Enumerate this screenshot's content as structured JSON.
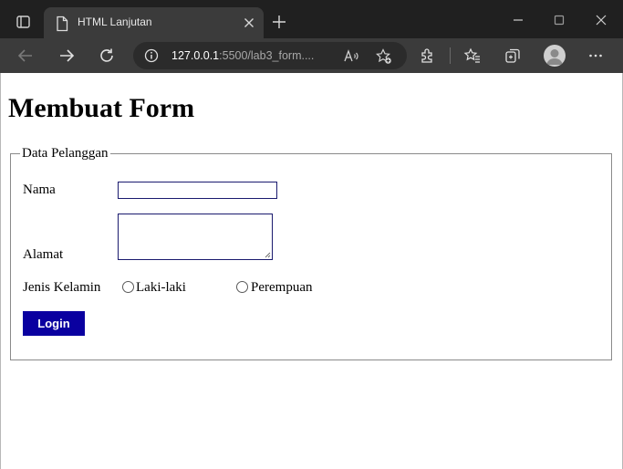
{
  "browser": {
    "tab": {
      "title": "HTML Lanjutan"
    },
    "address_bar": {
      "host": "127.0.0.1",
      "path": ":5500/lab3_form...."
    }
  },
  "page": {
    "heading": "Membuat Form",
    "fieldset_legend": "Data Pelanggan",
    "fields": {
      "name_label": "Nama",
      "name_value": "",
      "address_label": "Alamat",
      "address_value": "",
      "gender_label": "Jenis Kelamin",
      "gender_options": [
        "Laki-laki",
        "Perempuan"
      ]
    },
    "submit_label": "Login"
  },
  "colors": {
    "button_bg": "#0a00a0",
    "input_border": "#1a1a6e",
    "titlebar_bg": "#202020",
    "toolbar_bg": "#3b3b3b"
  }
}
